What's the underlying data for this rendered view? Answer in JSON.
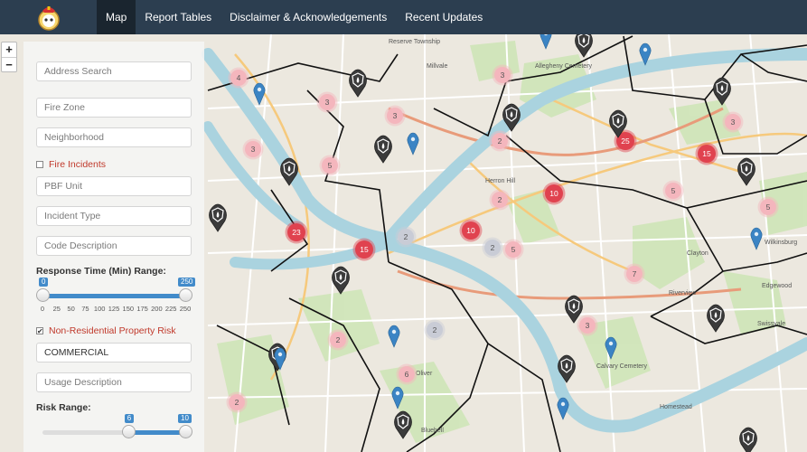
{
  "nav": {
    "items": [
      {
        "label": "Map",
        "active": true
      },
      {
        "label": "Report Tables",
        "active": false
      },
      {
        "label": "Disclaimer & Acknowledgements",
        "active": false
      },
      {
        "label": "Recent Updates",
        "active": false
      }
    ]
  },
  "zoom": {
    "in": "+",
    "out": "−"
  },
  "panel": {
    "address_placeholder": "Address Search",
    "fire_zone_placeholder": "Fire Zone",
    "neighborhood_placeholder": "Neighborhood",
    "fire_incidents_label": "Fire Incidents",
    "fire_incidents_checked": false,
    "pbf_unit_placeholder": "PBF Unit",
    "incident_type_placeholder": "Incident Type",
    "code_description_placeholder": "Code Description",
    "response_time_label": "Response Time (Min) Range:",
    "response_time": {
      "min": 0,
      "max": 250,
      "from": 0,
      "to": 250,
      "from_label": "0",
      "to_label": "250",
      "ticks": [
        "0",
        "25",
        "50",
        "75",
        "100",
        "125",
        "150",
        "175",
        "200",
        "225",
        "250"
      ]
    },
    "nonres_label": "Non-Residential Property Risk",
    "nonres_checked": true,
    "nonres_check_glyph": "✔",
    "usage_value": "COMMERCIAL",
    "usage_description_placeholder": "Usage Description",
    "risk_label": "Risk Range:",
    "risk": {
      "min": 0,
      "max": 10,
      "from": 6,
      "to": 10,
      "from_label": "6",
      "to_label": "10"
    }
  },
  "map": {
    "labels": {
      "millvale": "Millvale",
      "allegheny_cemetery": "Allegheny Cemetery",
      "herron_hill": "Herron Hill",
      "oliver": "Oliver",
      "homestead": "Homestead",
      "edgewood": "Edgewood",
      "swissvale": "Swissvale",
      "riverview": "Riverview",
      "calvary_cemetery": "Calvary Cemetery",
      "bluebell": "Bluebell",
      "wilkinsburg": "Wilkinsburg",
      "reserve_township": "Reserve Township",
      "clayton": "Clayton"
    },
    "clusters": [
      {
        "count": "4",
        "risk": "low"
      },
      {
        "count": "3",
        "risk": "low"
      },
      {
        "count": "3",
        "risk": "low"
      },
      {
        "count": "3",
        "risk": "low"
      },
      {
        "count": "5",
        "risk": "low"
      },
      {
        "count": "3",
        "risk": "low"
      },
      {
        "count": "2",
        "risk": "low"
      },
      {
        "count": "3",
        "risk": "low"
      },
      {
        "count": "25",
        "risk": "high"
      },
      {
        "count": "15",
        "risk": "high"
      },
      {
        "count": "2",
        "risk": "low"
      },
      {
        "count": "10",
        "risk": "high"
      },
      {
        "count": "5",
        "risk": "low"
      },
      {
        "count": "23",
        "risk": "high"
      },
      {
        "count": "15",
        "risk": "high"
      },
      {
        "count": "2",
        "risk": "neutral"
      },
      {
        "count": "10",
        "risk": "high"
      },
      {
        "count": "2",
        "risk": "neutral"
      },
      {
        "count": "5",
        "risk": "low"
      },
      {
        "count": "7",
        "risk": "low"
      },
      {
        "count": "3",
        "risk": "low"
      },
      {
        "count": "2",
        "risk": "low"
      },
      {
        "count": "2",
        "risk": "neutral"
      },
      {
        "count": "6",
        "risk": "low"
      },
      {
        "count": "2",
        "risk": "low"
      },
      {
        "count": "5",
        "risk": "low"
      }
    ]
  },
  "colors": {
    "navbar": "#2c3e50",
    "cluster_high": "#e0424f",
    "cluster_low": "#f4b6bd",
    "marker_blue": "#3b84c4",
    "marker_dark": "#3b3b3b",
    "river": "#aad3df"
  }
}
